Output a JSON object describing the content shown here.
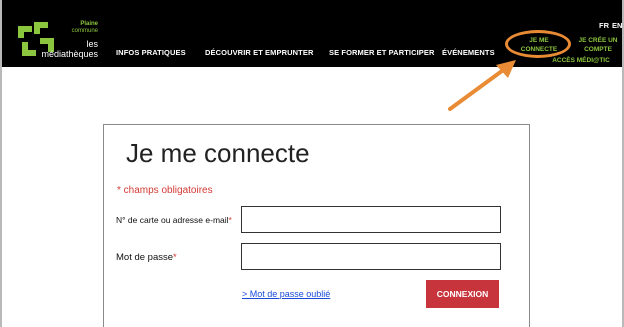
{
  "header": {
    "logo": {
      "line1": "Plaine",
      "line2": "commune",
      "line3": "les",
      "line4": "médiathèques",
      "colors": [
        "#8cc63f",
        "#ffffff"
      ]
    },
    "nav": [
      {
        "label": "INFOS PRATIQUES"
      },
      {
        "label": "DÉCOUVRIR ET EMPRUNTER"
      },
      {
        "label": "SE FORMER ET PARTICIPER"
      },
      {
        "label": "ÉVÉNEMENTS"
      }
    ],
    "lang": {
      "fr": "FR",
      "en": "EN"
    },
    "account": {
      "connect_line1": "JE ME",
      "connect_line2": "CONNECTE",
      "create_line1": "JE CRÉE UN",
      "create_line2": "COMPTE",
      "meditic": "ACCÈS MÉDI@TIC"
    }
  },
  "annotation": {
    "color": "#e88b34",
    "icon": "arrow-icon"
  },
  "form": {
    "title": "Je me connecte",
    "required_note": "* champs obligatoires",
    "card_field_label": "N° de carte ou adresse e-mail",
    "password_label": "Mot de passe",
    "required_star": "*",
    "card_field_value": "",
    "password_value": "",
    "forgot_link": "> Mot de passe oublié",
    "submit_label": "CONNEXION",
    "accent_color": "#c8343b",
    "link_color": "#1a4bd8"
  }
}
